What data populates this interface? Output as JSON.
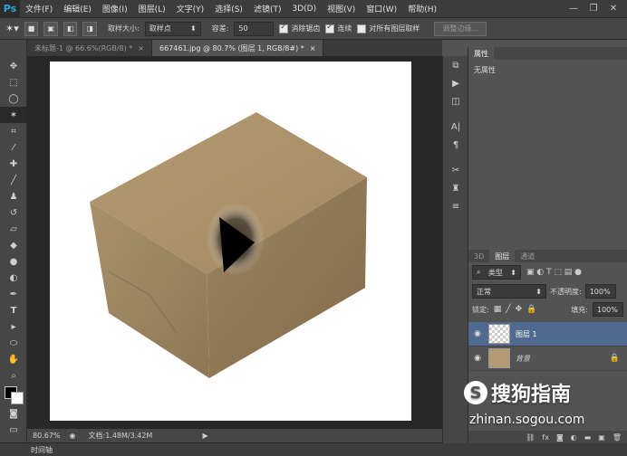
{
  "app": {
    "logo": "Ps"
  },
  "menu": [
    "文件(F)",
    "编辑(E)",
    "图像(I)",
    "图层(L)",
    "文字(Y)",
    "选择(S)",
    "滤镜(T)",
    "3D(D)",
    "视图(V)",
    "窗口(W)",
    "帮助(H)"
  ],
  "window_controls": {
    "minimize": "—",
    "restore": "❐",
    "close": "✕"
  },
  "options": {
    "sample_size_label": "取样大小:",
    "sample_size_value": "取样点",
    "tolerance_label": "容差:",
    "tolerance_value": "50",
    "antialias_label": "消除锯齿",
    "contiguous_label": "连续",
    "all_layers_label": "对所有图层取样",
    "refine_edge_label": "调整边缘..."
  },
  "tabs": [
    {
      "label": "未标题-1 @ 66.6%(RGB/8) *",
      "close": "×"
    },
    {
      "label": "667461.jpg @ 80.7% (图层 1, RGB/8#) *",
      "close": "×"
    }
  ],
  "status": {
    "zoom": "80.67%",
    "doc": "文档:1.48M/3.42M"
  },
  "timeline": {
    "label": "时间轴"
  },
  "properties": {
    "tab": "属性",
    "text": "无属性"
  },
  "layers_panel": {
    "tabs": [
      "3D",
      "图层",
      "通道"
    ],
    "kind_label": "类型",
    "blend_mode": "正常",
    "opacity_label": "不透明度:",
    "opacity_value": "100%",
    "lock_label": "锁定:",
    "fill_label": "填充:",
    "fill_value": "100%",
    "layers": [
      {
        "name": "图层 1"
      },
      {
        "name": "背景"
      }
    ]
  },
  "watermark": {
    "brand": "搜狗指南",
    "url": "zhinan.sogou.com"
  }
}
